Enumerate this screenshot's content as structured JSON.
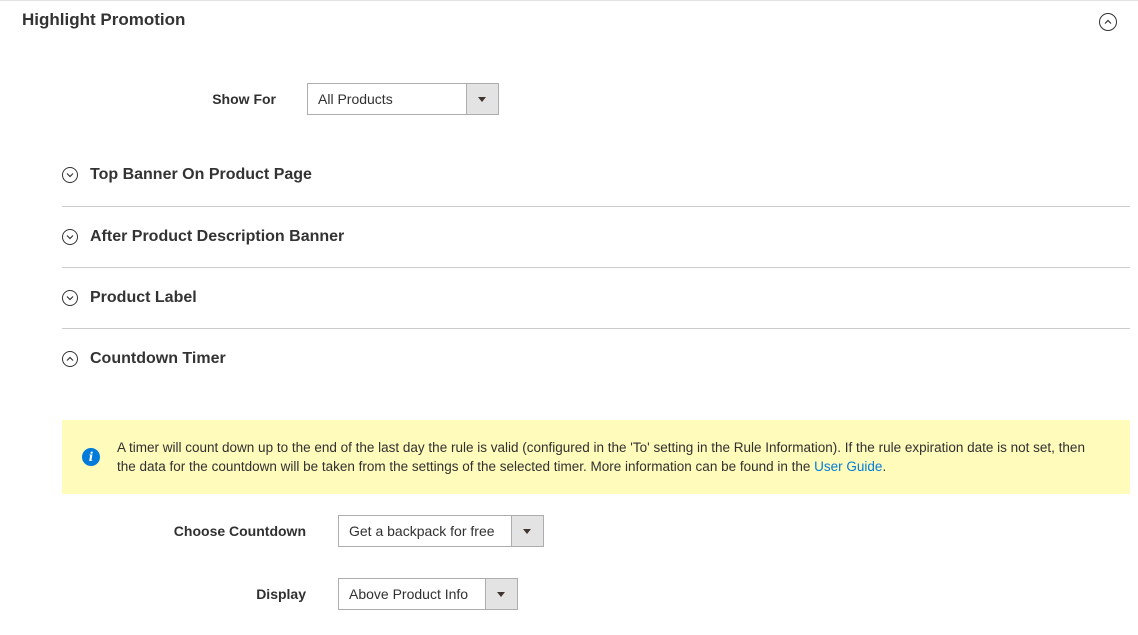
{
  "section": {
    "title": "Highlight Promotion"
  },
  "show_for": {
    "label": "Show For",
    "value": "All Products"
  },
  "groups": [
    {
      "title": "Top Banner On Product Page",
      "state": "collapsed"
    },
    {
      "title": "After Product Description Banner",
      "state": "collapsed"
    },
    {
      "title": "Product Label",
      "state": "collapsed"
    },
    {
      "title": "Countdown Timer",
      "state": "expanded"
    }
  ],
  "notice": {
    "text": "A timer will count down up to the end of the last day the rule is valid (configured in the 'To' setting in the Rule Information). If the rule expiration date is not set, then the data for the countdown will be taken from the settings of the selected timer. More information can be found in the ",
    "link": "User Guide",
    "suffix": "."
  },
  "choose_countdown": {
    "label": "Choose Countdown",
    "value": "Get a backpack for free"
  },
  "display": {
    "label": "Display",
    "value": "Above Product Info"
  },
  "colors": {
    "accent": "#007bdb",
    "notice_bg": "#fffbbb"
  }
}
